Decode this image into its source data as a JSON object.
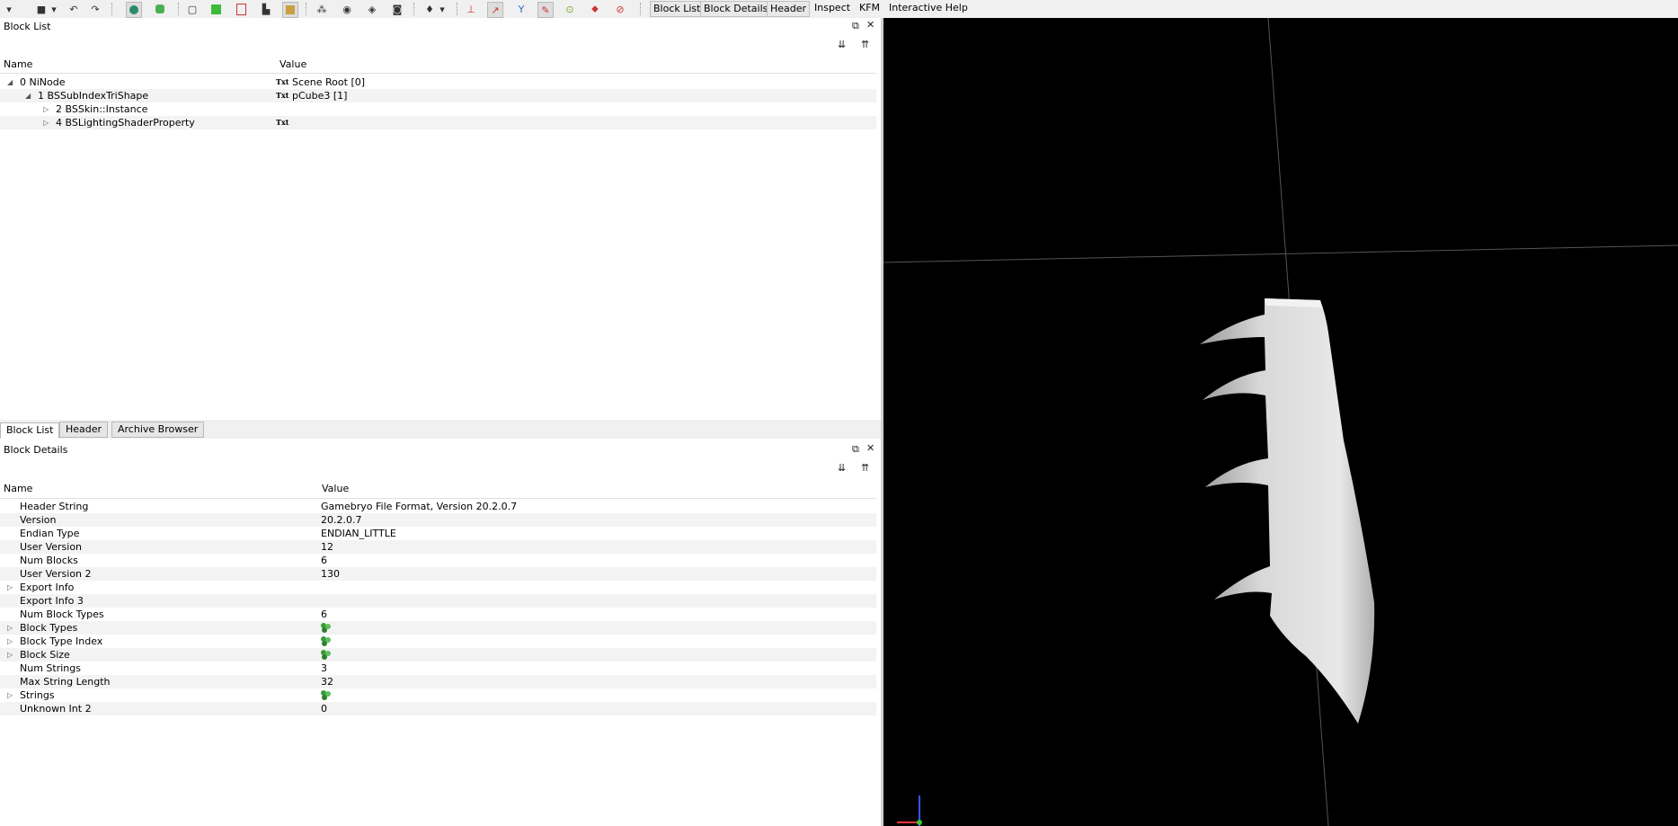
{
  "toolbar": {
    "tabs": [
      "Block List",
      "Block Details",
      "Header",
      "Inspect",
      "KFM",
      "Interactive Help"
    ]
  },
  "block_list": {
    "title": "Block List",
    "columns": [
      "Name",
      "Value"
    ],
    "rows": [
      {
        "name": "0 NiNode",
        "value": "Scene Root [0]",
        "badge": "Txt"
      },
      {
        "name": "1 BSSubIndexTriShape",
        "value": "pCube3 [1]",
        "badge": "Txt"
      },
      {
        "name": "2 BSSkin::Instance",
        "value": "",
        "badge": ""
      },
      {
        "name": "4 BSLightingShaderProperty",
        "value": "",
        "badge": "Txt"
      }
    ]
  },
  "tabs": [
    "Block List",
    "Header",
    "Archive Browser"
  ],
  "block_details": {
    "title": "Block Details",
    "columns": [
      "Name",
      "Value"
    ],
    "rows": [
      {
        "name": "Header String",
        "value": "Gamebryo File Format, Version 20.2.0.7"
      },
      {
        "name": "Version",
        "value": "20.2.0.7"
      },
      {
        "name": "Endian Type",
        "value": "ENDIAN_LITTLE"
      },
      {
        "name": "User Version",
        "value": "12"
      },
      {
        "name": "Num Blocks",
        "value": "6"
      },
      {
        "name": "User Version 2",
        "value": "130"
      },
      {
        "name": "Export Info",
        "value": ""
      },
      {
        "name": "Export Info 3",
        "value": ""
      },
      {
        "name": "Num Block Types",
        "value": "6"
      },
      {
        "name": "Block Types",
        "value": ""
      },
      {
        "name": "Block Type Index",
        "value": ""
      },
      {
        "name": "Block Size",
        "value": ""
      },
      {
        "name": "Num Strings",
        "value": "3"
      },
      {
        "name": "Max String Length",
        "value": "32"
      },
      {
        "name": "Strings",
        "value": ""
      },
      {
        "name": "Unknown Int 2",
        "value": "0"
      }
    ]
  }
}
